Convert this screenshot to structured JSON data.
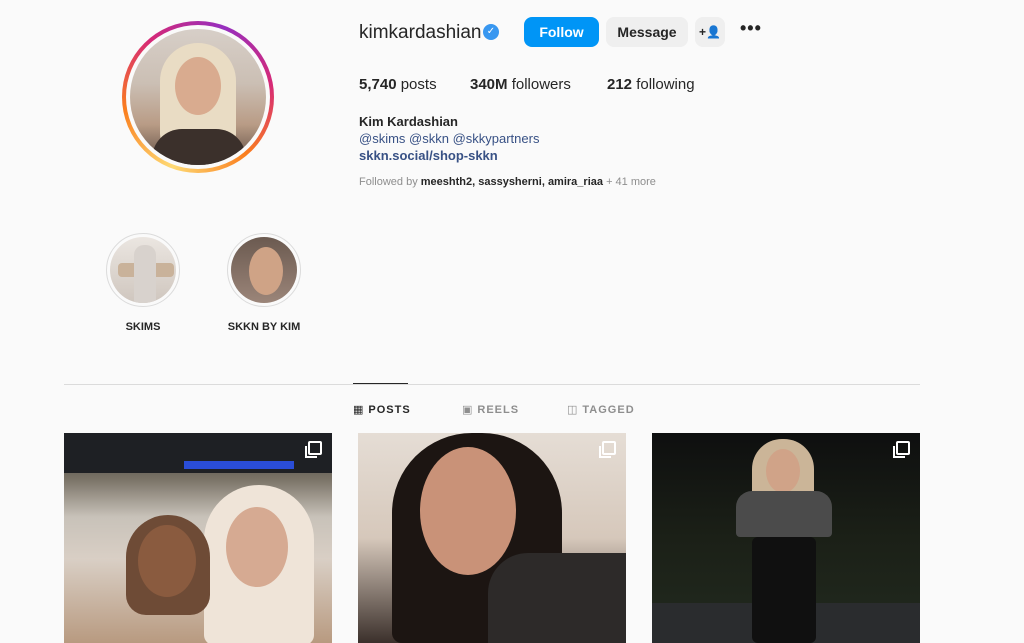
{
  "profile": {
    "username": "kimkardashian",
    "verified_icon": "✓",
    "follow_label": "Follow",
    "message_label": "Message",
    "add_user_icon": "+👤",
    "more_icon": "•••"
  },
  "stats": {
    "posts_count": "5,740",
    "posts_label": "posts",
    "followers_count": "340M",
    "followers_label": "followers",
    "following_count": "212",
    "following_label": "following"
  },
  "bio": {
    "name": "Kim Kardashian",
    "tags": "@skims @skkn @skkypartners",
    "link": "skkn.social/shop-skkn",
    "followed_by_prefix": "Followed by",
    "followed_by_names": "meeshth2, sassysherni, amira_riaa",
    "followed_by_suffix": "+ 41 more"
  },
  "highlights": [
    {
      "label": "SKIMS"
    },
    {
      "label": "SKKN BY KIM"
    }
  ],
  "tabs": [
    {
      "label": "POSTS",
      "icon": "grid-icon",
      "active": true
    },
    {
      "label": "REELS",
      "icon": "reels-icon",
      "active": false
    },
    {
      "label": "TAGGED",
      "icon": "tagged-icon",
      "active": false
    }
  ],
  "colors": {
    "follow_button": "#0095f6",
    "verified": "#3897f0",
    "link": "#385185"
  }
}
